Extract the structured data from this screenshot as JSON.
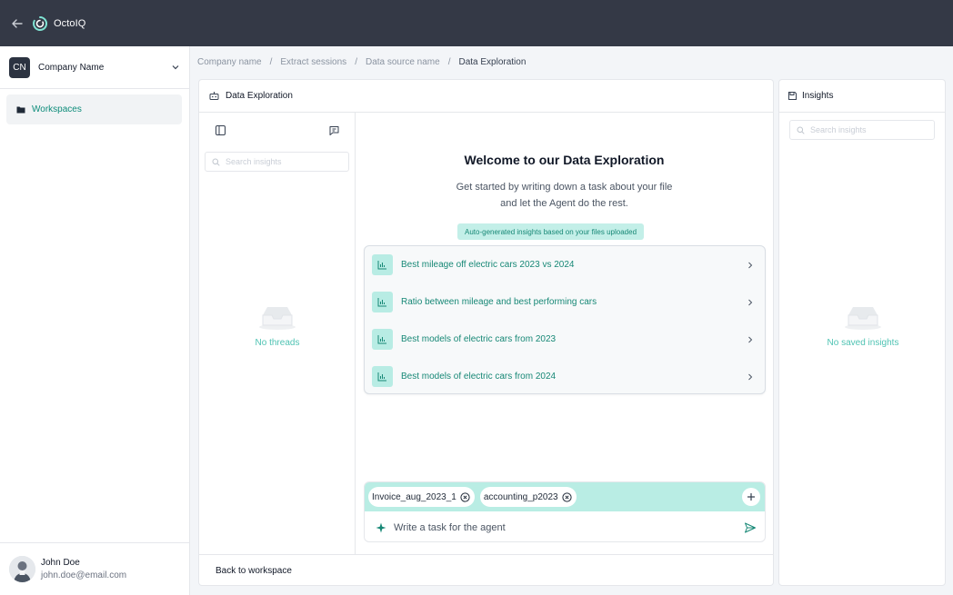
{
  "app": {
    "brand": "OctoIQ"
  },
  "sidebar": {
    "company_initials": "CN",
    "company_name": "Company Name",
    "nav": [
      {
        "label": "Workspaces",
        "icon": "folder-icon"
      }
    ],
    "user": {
      "name": "John Doe",
      "email": "john.doe@email.com"
    }
  },
  "breadcrumb": [
    "Company name",
    "Extract sessions",
    "Data source name",
    "Data Exploration"
  ],
  "main": {
    "title": "Data Exploration",
    "threads": {
      "search_placeholder": "Search insights",
      "empty_text": "No threads"
    },
    "welcome": {
      "title": "Welcome to our Data Exploration",
      "subtitle_line1": "Get started by writing down a task about your file",
      "subtitle_line2": "and let the Agent do the rest.",
      "badge": "Auto-generated insights based on your files uploaded"
    },
    "suggestions": [
      "Best mileage off electric cars 2023 vs 2024",
      "Ratio between mileage and best performing cars",
      "Best models of electric cars from 2023",
      "Best models of electric cars from 2024"
    ],
    "files": [
      "Invoice_aug_2023_1",
      "accounting_p2023"
    ],
    "task_placeholder": "Write a task for the agent",
    "footer_link": "Back to workspace"
  },
  "insights": {
    "title": "Insights",
    "search_placeholder": "Search insights",
    "empty_text": "No saved insights"
  },
  "colors": {
    "topbar": "#343946",
    "accent": "#0d8c7a",
    "accent_light": "#b9ede4"
  }
}
